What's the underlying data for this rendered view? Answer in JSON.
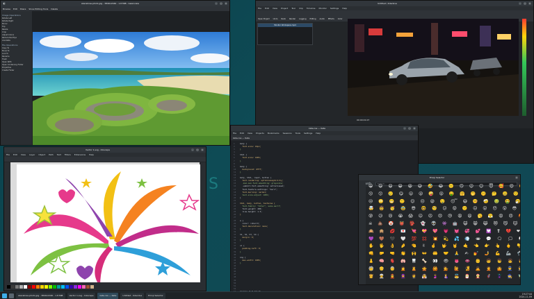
{
  "gwenview": {
    "title": "skarabrae-photo.jpg - 3840x2160 - 1.8 MiB - Gwenview",
    "toolbar": [
      "Browse",
      "Edit",
      "Share",
      "Show Editing Tools",
      "Delete"
    ],
    "sidebar_sections": [
      "Image Operations",
      "File Operations"
    ],
    "image_ops": [
      "Rotate Left",
      "Rotate Right",
      "Mirror",
      "Flip",
      "Resize",
      "Crop",
      "Adjust Colors",
      "Reduce Red Eye",
      "Annotate"
    ],
    "file_ops": [
      "Copy To",
      "Move To",
      "Link To",
      "Rename",
      "Trash",
      "Open With",
      "Open Containing Folder",
      "Properties",
      "Create Folder"
    ]
  },
  "kdenlive": {
    "title": "Untitled / Kdenlive",
    "menu": [
      "File",
      "Edit",
      "View",
      "Project",
      "Tool",
      "Clip",
      "Timeline",
      "Monitor",
      "Settings",
      "Help"
    ],
    "toolbar": [
      "Open Project",
      "Undo",
      "Redo",
      "Render",
      "Logging",
      "Editing",
      "Audio",
      "Effects",
      "Color"
    ],
    "clip_monitor_label": "Monitor Workspace.mp4",
    "timecode": "00:00:01:07"
  },
  "kate": {
    "title": "kate.css — Kate",
    "menu": [
      "File",
      "Edit",
      "View",
      "Projects",
      "Bookmarks",
      "Sessions",
      "Tools",
      "Settings",
      "Help"
    ],
    "code_lines": [
      "body {",
      "  font-size: 16px;",
      "}",
      "",
      "html {",
      "  font-size: 100%;",
      "}",
      "",
      "body {",
      "  background: #fff;",
      "}",
      "",
      "body, html, input, button {",
      "  text-rendering: optimizeLegibility;",
      "  -moz-osx-font-smoothing: grayscale;",
      "  -webkit-font-smoothing: antialiased;",
      "  font-feature-settings: \"kern\";",
      "  font-kerning: normal;",
      "  text-size-adjust: 100%;",
      "}",
      "",
      "html, body, button, textarea {",
      "  font-family: \"Inter\", sans-serif;",
      "  font-weight: 400;",
      "  line-height: 1.5;",
      "}",
      "",
      "a {",
      "  color: inherit;",
      "  text-decoration: none;",
      "}",
      "",
      "h1, h2, h3, h4 {",
      "  margin: 0;",
      "}",
      "",
      "ul {",
      "  padding-left: 0;",
      "}",
      "",
      "img {",
      "  max-width: 100%;",
      "}",
      "",
      "",
      "",
      "",
      "",
      "",
      "",
      "",
      "",
      "margin: 0 0 1em 0;"
    ],
    "status": "Line 1, Column 1  INSERT  Soft Tabs: 4  UTF-8  CSS"
  },
  "emoji": {
    "title": "Emoji Selector",
    "heading": "Search",
    "search_placeholder": "Search...",
    "rows": [
      "😀 😃 😄 😁 😆 😅 🤣 😂 🙂 🙃 😉 😊 😇 🥰 😍 🤩 😘 😗 ☺",
      "😚 😙 🥲 😋 😛 😜 🤪 😝 🤑 🤗 🤭 🤫 🤔 🤐 🤨 😐 😑 😶 😏",
      "😒 🙄 😬 🤥 😌 😔 😪 🤤 😴 😷 🤒 🤕 🤢 🤮 🤧 🥵 🥶 🥴 😵",
      "🤯 🤠 🥳 🥸 😎 🤓 🧐 😕 😟 🙁 ☹ 😮 😯 😲 😳 🥺 😦 😧 😨",
      "😰 😥 😢 😭 😱 😖 😣 😞 😓 😩 😫 🥱 😤 😡 😠 🤬 😈 👿 💀",
      "☠ 💩 🤡 👹 👺 👻 👽 👾 🤖 😺 😸 😹 😻 😼 😽 🙀 😿 😾 🙈",
      "🙉 🙊 💋 💌 💘 💝 💖 💗 💓 💞 💕 💟 ❣ 💔 ❤ 🧡 💛 💚 💙",
      "💜 🤎 🖤 🤍 💯 💢 💥 💫 💦 💨 🕳 💬 🗨 🗯 💭 💤 👋 🤚 🖐",
      "✋ 🖖 👌 🤌 🤏 ✌ 🤞 🤟 🤘 🤙 👈 👉 👆 🖕 👇 ☝ 👍 👎 ✊",
      "👊 🤛 🤜 👏 🙌 👐 🤲 🤝 🙏 ✍ 💅 🤳 💪 🦾 🦿 🦵 🦶 👂 🦻",
      "👃 🧠 🫀 🫁 🦷 🦴 👀 👁 👅 👄 👶 🧒 👦 👧 🧑 👱 👨 🧔 👩",
      "🧓 👴 👵 🙍 🙎 🙅 🙆 💁 🙋 🧏 🙇 🤦 🤷 👮 🕵 💂 🥷 👷 🤴",
      "👸 👳 👲 🧕 🤵 👰 🤰 🤱 👼 🎅 🤶 🦸 🦹 🧙 🧚 🧛 🧜 🧝 🧞"
    ]
  },
  "inkscape": {
    "title": "Vector 1.svg - Inkscape",
    "menu": [
      "File",
      "Edit",
      "View",
      "Layer",
      "Object",
      "Path",
      "Text",
      "Filters",
      "Extensions",
      "Help"
    ],
    "palette": [
      "#000000",
      "#3b3b3b",
      "#7a7a7a",
      "#b4b4b4",
      "#ffffff",
      "#8b0000",
      "#ff0000",
      "#ff7f00",
      "#ffd700",
      "#ffff00",
      "#7fff00",
      "#00c000",
      "#00a0a0",
      "#00bfff",
      "#0050ff",
      "#3a00b0",
      "#8a2be2",
      "#ff00ff",
      "#ff69b4",
      "#a0522d",
      "#d2b48c"
    ]
  },
  "taskbar": {
    "tasks": [
      "skarabrae-photo.jpg - 3840x2160 - 1.8 MiB",
      "Vector 1.svg - Inkscape",
      "kate.css — Kate",
      "Untitled - Kdenlive",
      "Emoji Selector"
    ],
    "time": "19:27:44",
    "date": "2024-11-09"
  },
  "colors": {
    "accent": "#3daee9",
    "desktop": "#0e4b55",
    "panel": "#1e2326"
  }
}
